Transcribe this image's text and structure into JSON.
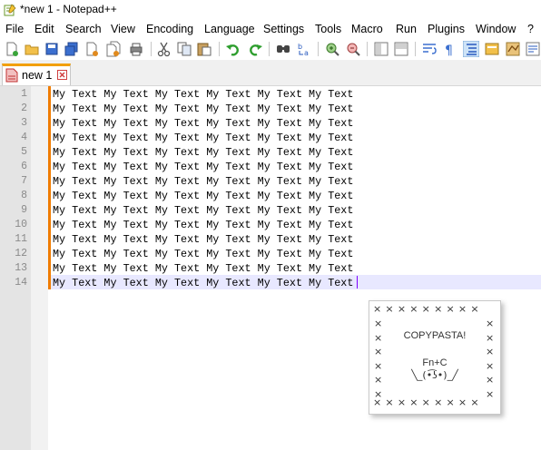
{
  "window": {
    "title": "*new 1 - Notepad++"
  },
  "menu": [
    "File",
    "Edit",
    "Search",
    "View",
    "Encoding",
    "Language",
    "Settings",
    "Tools",
    "Macro",
    "Run",
    "Plugins",
    "Window",
    "?"
  ],
  "tab": {
    "label": "new 1",
    "close_icon": "close-icon"
  },
  "editor": {
    "line_numbers": [
      "1",
      "2",
      "3",
      "4",
      "5",
      "6",
      "7",
      "8",
      "9",
      "10",
      "11",
      "12",
      "13",
      "14"
    ],
    "lines": [
      "My Text My Text My Text My Text My Text My Text",
      "My Text My Text My Text My Text My Text My Text",
      "My Text My Text My Text My Text My Text My Text",
      "My Text My Text My Text My Text My Text My Text",
      "My Text My Text My Text My Text My Text My Text",
      "My Text My Text My Text My Text My Text My Text",
      "My Text My Text My Text My Text My Text My Text",
      "My Text My Text My Text My Text My Text My Text",
      "My Text My Text My Text My Text My Text My Text",
      "My Text My Text My Text My Text My Text My Text",
      "My Text My Text My Text My Text My Text My Text",
      "My Text My Text My Text My Text My Text My Text",
      "My Text My Text My Text My Text My Text My Text",
      "My Text My Text My Text My Text My Text My Text"
    ],
    "current_line": 14
  },
  "popup": {
    "border_row": "×××××××××",
    "border_col": "×\n×\n×\n×\n×\n×",
    "title": "COPYPASTA!",
    "shortcut": "Fn+C",
    "face": "╲_(•͡ʖ•)_╱"
  },
  "colors": {
    "tab_accent": "#f29f05",
    "change_bar": "#f07c00",
    "caret": "#8000ff",
    "current_line_bg": "#e8e8ff"
  }
}
